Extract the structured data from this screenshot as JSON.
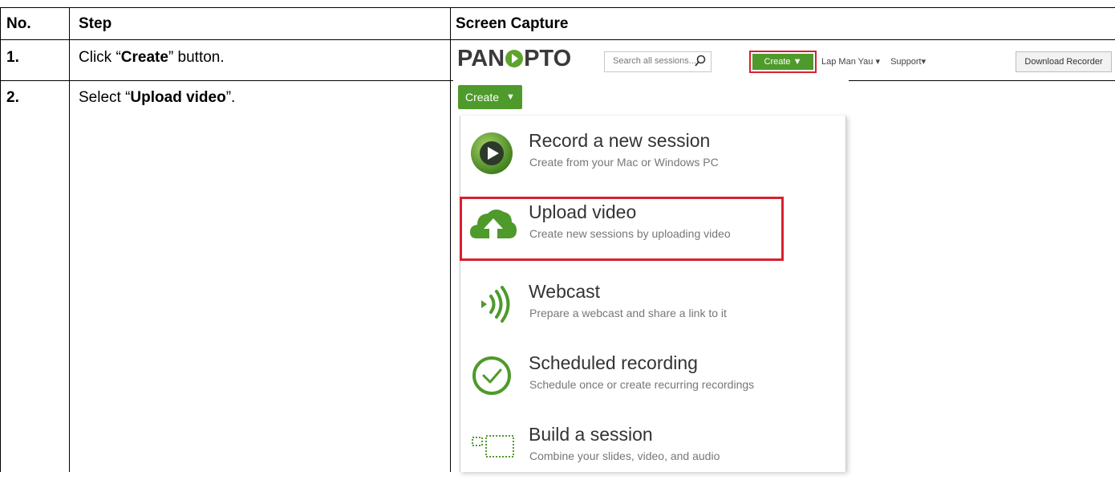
{
  "table": {
    "headers": {
      "no": "No.",
      "step": "Step",
      "capture": "Screen Capture"
    },
    "rows": [
      {
        "no": "1.",
        "pre": "Click “",
        "bold": "Create",
        "post": "” button."
      },
      {
        "no": "2.",
        "pre": "Select “",
        "bold": "Upload video",
        "post": "”."
      }
    ]
  },
  "panopto_bar": {
    "logo_left": "PAN",
    "logo_right": "PTO",
    "search_placeholder": "Search all sessions...",
    "create_label": "Create ▼",
    "user_link": "Lap Man Yau ▾",
    "support_link": "Support▾",
    "download_label": "Download Recorder"
  },
  "create_menu": {
    "button_label": "Create",
    "arrow": "▼",
    "items": [
      {
        "title": "Record a new session",
        "subtitle": "Create from your Mac or Windows PC",
        "icon": "record-play-icon"
      },
      {
        "title": "Upload video",
        "subtitle": "Create new sessions by uploading video",
        "icon": "cloud-upload-icon"
      },
      {
        "title": "Webcast",
        "subtitle": "Prepare a webcast and share a link to it",
        "icon": "broadcast-icon"
      },
      {
        "title": "Scheduled recording",
        "subtitle": "Schedule once or create recurring recordings",
        "icon": "clock-check-icon"
      },
      {
        "title": "Build a session",
        "subtitle": "Combine your slides, video, and audio",
        "icon": "build-session-icon"
      }
    ]
  },
  "colors": {
    "green": "#4e9a2b",
    "highlight_red": "#d8202f"
  }
}
